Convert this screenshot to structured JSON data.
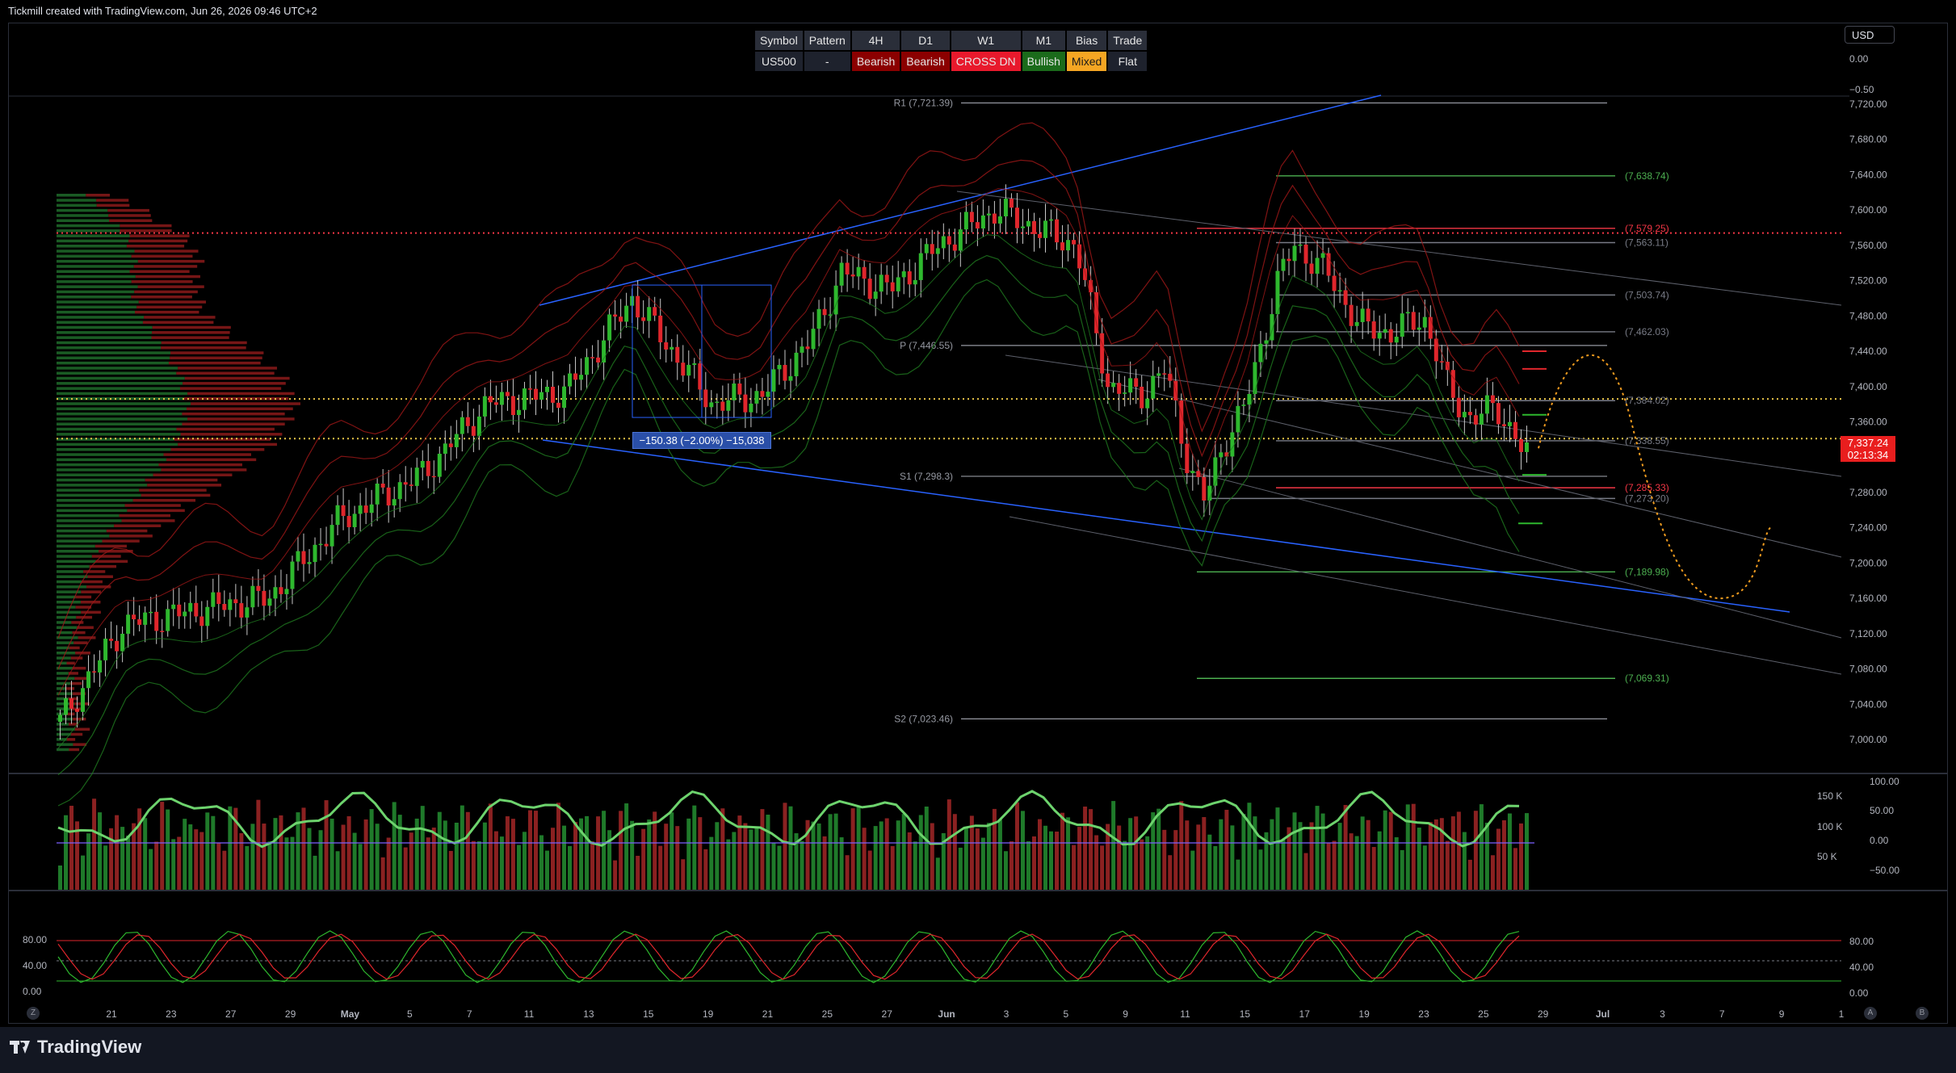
{
  "credit": "Tickmill created with TradingView.com, Jun 26, 2026 09:46 UTC+2",
  "footer": {
    "logo_text": "TradingView"
  },
  "signal_table": {
    "headers": [
      "Symbol",
      "Pattern",
      "4H",
      "D1",
      "W1",
      "M1",
      "Bias",
      "Trade"
    ],
    "values": [
      "US500",
      "-",
      "Bearish",
      "Bearish",
      "CROSS DN",
      "Bullish",
      "Mixed",
      "Flat"
    ],
    "value_colors": [
      "#1e222d",
      "#1e222d",
      "#8b0000",
      "#8b0000",
      "#e8192c",
      "#1b6b1b",
      "#f5a623",
      "#1e222d"
    ]
  },
  "currency_button": "USD",
  "last_price": {
    "price": "7,337.24",
    "countdown": "02:13:34",
    "color": "#e91e1e"
  },
  "measure_label": "−150.38 (−2.00%) −15,038",
  "colors": {
    "up": "#2eb82e",
    "down": "#e0262c",
    "trend": "#2962ff",
    "projection": "#f29c1f"
  },
  "chart_data": {
    "type": "candlestick",
    "symbol": "US500",
    "price_axis": {
      "range": [
        6990,
        7730
      ],
      "ticks": [
        "7,720.00",
        "7,680.00",
        "7,640.00",
        "7,600.00",
        "7,560.00",
        "7,520.00",
        "7,480.00",
        "7,440.00",
        "7,400.00",
        "7,360.00",
        "7,320.00",
        "7,280.00",
        "7,240.00",
        "7,200.00",
        "7,160.00",
        "7,120.00",
        "7,080.00",
        "7,040.00",
        "7,000.00"
      ],
      "top_labels": [
        "0.00",
        "−0.50"
      ]
    },
    "time_axis": {
      "labels": [
        "21",
        "23",
        "27",
        "29",
        "May",
        "5",
        "7",
        "11",
        "13",
        "15",
        "19",
        "21",
        "25",
        "27",
        "Jun",
        "3",
        "5",
        "9",
        "11",
        "15",
        "17",
        "19",
        "23",
        "25",
        "29",
        "Jul",
        "3",
        "7",
        "9",
        "1"
      ],
      "bold": [
        "May",
        "Jun",
        "Jul"
      ]
    },
    "pivots": [
      {
        "label": "R1 (7,721.39)",
        "value": 7721.39
      },
      {
        "label": "P (7,446.55)",
        "value": 7446.55
      },
      {
        "label": "S1 (7,298.3)",
        "value": 7298.3
      },
      {
        "label": "S2 (7,023.46)",
        "value": 7023.46
      }
    ],
    "levels": [
      {
        "label": "(7,638.74)",
        "value": 7638.74,
        "color": "#4caf50"
      },
      {
        "label": "(7,579.25)",
        "value": 7579.25,
        "color": "#f23645"
      },
      {
        "label": "(7,563.11)",
        "value": 7563.11,
        "color": "#787b86"
      },
      {
        "label": "(7,503.74)",
        "value": 7503.74,
        "color": "#787b86"
      },
      {
        "label": "(7,462.03)",
        "value": 7462.03,
        "color": "#787b86"
      },
      {
        "label": "(7,384.02)",
        "value": 7384.02,
        "color": "#787b86"
      },
      {
        "label": "(7,338.55)",
        "value": 7338.55,
        "color": "#787b86"
      },
      {
        "label": "(7,285.33)",
        "value": 7285.33,
        "color": "#f23645"
      },
      {
        "label": "(7,273.20)",
        "value": 7273.2,
        "color": "#787b86"
      },
      {
        "label": "(7,189.98)",
        "value": 7189.98,
        "color": "#4caf50"
      },
      {
        "label": "(7,069.31)",
        "value": 7069.31,
        "color": "#4caf50"
      }
    ],
    "dotted_lines": [
      {
        "value": 7574,
        "color": "#f23645"
      },
      {
        "value": 7386,
        "color": "#e8c547"
      },
      {
        "value": 7341,
        "color": "#e8c547"
      }
    ],
    "volume_axis": [
      "150 K",
      "100 K",
      "50 K"
    ],
    "oscillator_axis": [
      "100.00",
      "50.00",
      "0.00",
      "−50.00"
    ],
    "stoch_axis_left": [
      "80.00",
      "40.00",
      "0.00"
    ],
    "stoch_axis_right": [
      "80.00",
      "40.00",
      "0.00"
    ]
  },
  "time_zone_buttons": [
    "Z",
    "A",
    "B"
  ]
}
